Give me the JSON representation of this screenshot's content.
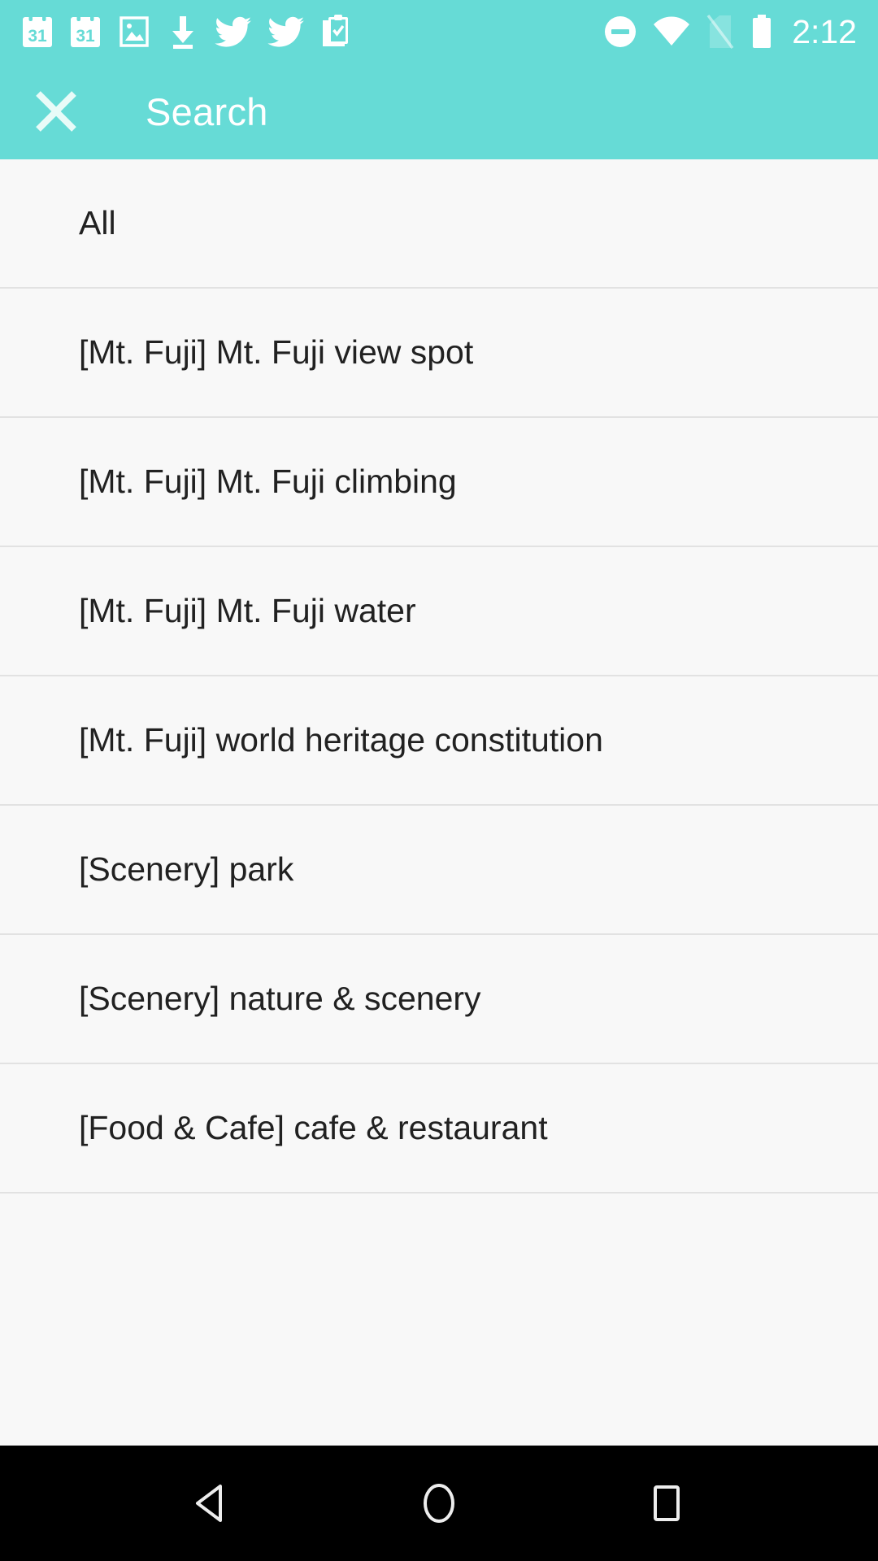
{
  "theme": {
    "accent": "#66DBD6",
    "list_bg": "#F8F8F8",
    "divider": "#E2E2E2",
    "text": "#212121",
    "on_accent": "#FFFFFF",
    "nav_bg": "#000000"
  },
  "status_bar": {
    "left_icons": [
      {
        "name": "calendar-icon",
        "label": "31"
      },
      {
        "name": "calendar-icon",
        "label": "31"
      },
      {
        "name": "image-icon",
        "label": ""
      },
      {
        "name": "download-icon",
        "label": ""
      },
      {
        "name": "twitter-icon",
        "label": ""
      },
      {
        "name": "twitter-icon",
        "label": ""
      },
      {
        "name": "clipboard-check-icon",
        "label": ""
      }
    ],
    "right_icons": [
      {
        "name": "do-not-disturb-icon"
      },
      {
        "name": "wifi-icon"
      },
      {
        "name": "sim-card-off-icon"
      },
      {
        "name": "battery-icon"
      }
    ],
    "time": "2:12"
  },
  "app_bar": {
    "close_label": "Close",
    "title": "Search"
  },
  "list": {
    "items": [
      {
        "label": "All"
      },
      {
        "label": "[Mt. Fuji] Mt. Fuji view spot"
      },
      {
        "label": "[Mt. Fuji] Mt. Fuji climbing"
      },
      {
        "label": "[Mt. Fuji] Mt. Fuji water"
      },
      {
        "label": "[Mt. Fuji] world heritage constitution"
      },
      {
        "label": "[Scenery] park"
      },
      {
        "label": "[Scenery] nature & scenery"
      },
      {
        "label": "[Food & Cafe] cafe & restaurant"
      }
    ]
  },
  "nav_bar": {
    "buttons": [
      {
        "name": "back-button"
      },
      {
        "name": "home-button"
      },
      {
        "name": "recents-button"
      }
    ]
  }
}
